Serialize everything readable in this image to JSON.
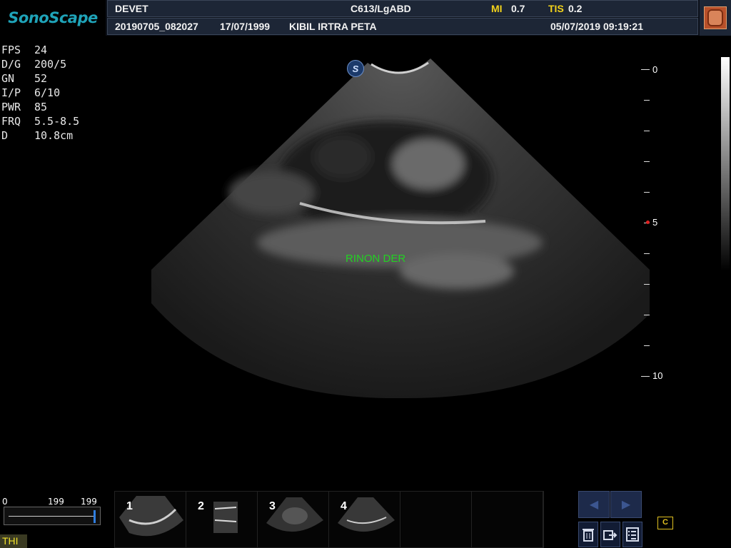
{
  "header": {
    "logo": "SonoScape",
    "patient_id_label": "DEVET",
    "probe_preset": "C613/LgABD",
    "mi_label": "MI",
    "mi_value": "0.7",
    "tis_label": "TIS",
    "tis_value": "0.2",
    "exam_id": "20190705_082027",
    "birth_date": "17/07/1999",
    "patient_name": "KIBIL IRTRA PETA",
    "datetime": "05/07/2019 09:19:21",
    "preset_icon": "kidney-organ-icon"
  },
  "params": [
    {
      "key": "FPS",
      "value": "24"
    },
    {
      "key": "D/G",
      "value": "200/5"
    },
    {
      "key": "GN",
      "value": "52"
    },
    {
      "key": "I/P",
      "value": "6/10"
    },
    {
      "key": "PWR",
      "value": "85"
    },
    {
      "key": "FRQ",
      "value": "5.5-8.5"
    },
    {
      "key": "D",
      "value": "10.8cm"
    }
  ],
  "image": {
    "annotation": "RINON DER",
    "annotation_color": "#22d122",
    "probe_marker": "S"
  },
  "depth_scale": {
    "labels": [
      "0",
      "5",
      "10"
    ],
    "focus_color": "#e02020"
  },
  "gray_scale": {
    "min": "0",
    "mid": "199",
    "max": "199"
  },
  "mode_badge": "THI",
  "thumbnails": [
    "1",
    "2",
    "3",
    "4"
  ],
  "controls": {
    "prev_icon": "chevron-left-icon",
    "next_icon": "chevron-right-icon",
    "delete_icon": "trash-icon",
    "export_icon": "export-icon",
    "report_icon": "checklist-icon",
    "cine_label": "C"
  }
}
